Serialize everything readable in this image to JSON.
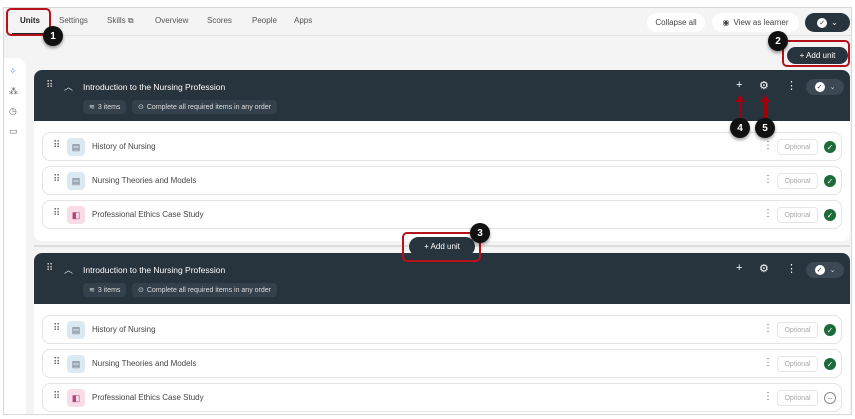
{
  "nav": {
    "tabs": [
      "Units",
      "Settings",
      "Skills",
      "Overview",
      "Scores",
      "People",
      "Apps"
    ],
    "skills_icon": "external-link-icon"
  },
  "toolbar": {
    "collapse_all": "Collapse all",
    "view_as_learner": "View as learner",
    "add_unit": "+ Add unit"
  },
  "units": [
    {
      "title": "Introduction to the Nursing Profession",
      "items_count": "3 items",
      "completion": "Complete all required items in any order",
      "items": [
        {
          "name": "History of Nursing",
          "type": "page",
          "optional": "Optional",
          "status": "complete"
        },
        {
          "name": "Nursing Theories and Models",
          "type": "page",
          "optional": "Optional",
          "status": "complete"
        },
        {
          "name": "Professional Ethics Case Study",
          "type": "assignment",
          "optional": "Optional",
          "status": "complete"
        }
      ]
    },
    {
      "title": "Introduction to the Nursing Profession",
      "items_count": "3 items",
      "completion": "Complete all required items in any order",
      "items": [
        {
          "name": "History of Nursing",
          "type": "page",
          "optional": "Optional",
          "status": "complete"
        },
        {
          "name": "Nursing Theories and Models",
          "type": "page",
          "optional": "Optional",
          "status": "complete"
        },
        {
          "name": "Professional Ethics Case Study",
          "type": "assignment",
          "optional": "Optional",
          "status": "incomplete"
        }
      ]
    }
  ],
  "add_unit_inline": "+ Add unit",
  "callouts": [
    "1",
    "2",
    "3",
    "4",
    "5"
  ],
  "colors": {
    "header": "#27333d",
    "complete": "#1d6b3a",
    "annotation": "#b5121b"
  }
}
